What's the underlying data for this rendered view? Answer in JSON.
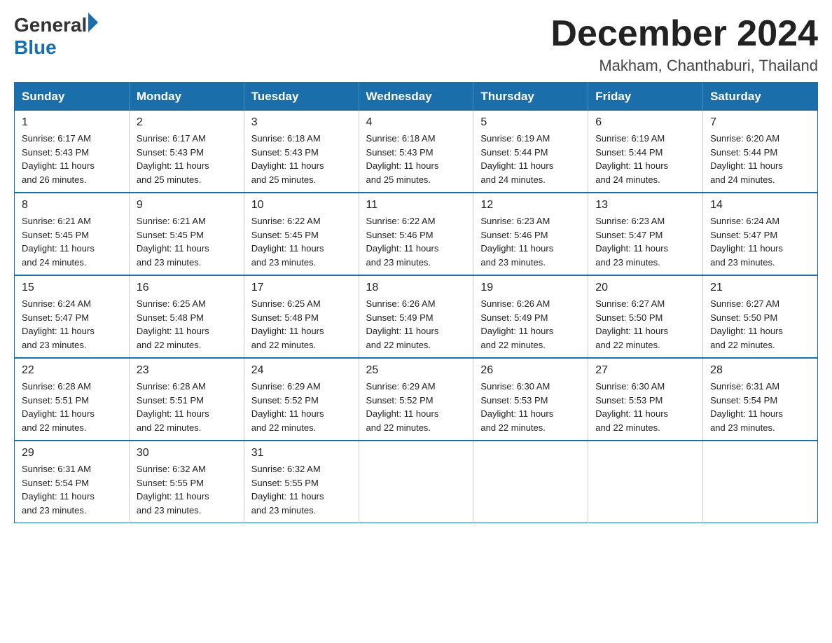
{
  "header": {
    "logo": {
      "general": "General",
      "blue": "Blue"
    },
    "month_year": "December 2024",
    "location": "Makham, Chanthaburi, Thailand"
  },
  "weekdays": [
    "Sunday",
    "Monday",
    "Tuesday",
    "Wednesday",
    "Thursday",
    "Friday",
    "Saturday"
  ],
  "weeks": [
    [
      {
        "day": "1",
        "sunrise": "6:17 AM",
        "sunset": "5:43 PM",
        "daylight": "11 hours and 26 minutes."
      },
      {
        "day": "2",
        "sunrise": "6:17 AM",
        "sunset": "5:43 PM",
        "daylight": "11 hours and 25 minutes."
      },
      {
        "day": "3",
        "sunrise": "6:18 AM",
        "sunset": "5:43 PM",
        "daylight": "11 hours and 25 minutes."
      },
      {
        "day": "4",
        "sunrise": "6:18 AM",
        "sunset": "5:43 PM",
        "daylight": "11 hours and 25 minutes."
      },
      {
        "day": "5",
        "sunrise": "6:19 AM",
        "sunset": "5:44 PM",
        "daylight": "11 hours and 24 minutes."
      },
      {
        "day": "6",
        "sunrise": "6:19 AM",
        "sunset": "5:44 PM",
        "daylight": "11 hours and 24 minutes."
      },
      {
        "day": "7",
        "sunrise": "6:20 AM",
        "sunset": "5:44 PM",
        "daylight": "11 hours and 24 minutes."
      }
    ],
    [
      {
        "day": "8",
        "sunrise": "6:21 AM",
        "sunset": "5:45 PM",
        "daylight": "11 hours and 24 minutes."
      },
      {
        "day": "9",
        "sunrise": "6:21 AM",
        "sunset": "5:45 PM",
        "daylight": "11 hours and 23 minutes."
      },
      {
        "day": "10",
        "sunrise": "6:22 AM",
        "sunset": "5:45 PM",
        "daylight": "11 hours and 23 minutes."
      },
      {
        "day": "11",
        "sunrise": "6:22 AM",
        "sunset": "5:46 PM",
        "daylight": "11 hours and 23 minutes."
      },
      {
        "day": "12",
        "sunrise": "6:23 AM",
        "sunset": "5:46 PM",
        "daylight": "11 hours and 23 minutes."
      },
      {
        "day": "13",
        "sunrise": "6:23 AM",
        "sunset": "5:47 PM",
        "daylight": "11 hours and 23 minutes."
      },
      {
        "day": "14",
        "sunrise": "6:24 AM",
        "sunset": "5:47 PM",
        "daylight": "11 hours and 23 minutes."
      }
    ],
    [
      {
        "day": "15",
        "sunrise": "6:24 AM",
        "sunset": "5:47 PM",
        "daylight": "11 hours and 23 minutes."
      },
      {
        "day": "16",
        "sunrise": "6:25 AM",
        "sunset": "5:48 PM",
        "daylight": "11 hours and 22 minutes."
      },
      {
        "day": "17",
        "sunrise": "6:25 AM",
        "sunset": "5:48 PM",
        "daylight": "11 hours and 22 minutes."
      },
      {
        "day": "18",
        "sunrise": "6:26 AM",
        "sunset": "5:49 PM",
        "daylight": "11 hours and 22 minutes."
      },
      {
        "day": "19",
        "sunrise": "6:26 AM",
        "sunset": "5:49 PM",
        "daylight": "11 hours and 22 minutes."
      },
      {
        "day": "20",
        "sunrise": "6:27 AM",
        "sunset": "5:50 PM",
        "daylight": "11 hours and 22 minutes."
      },
      {
        "day": "21",
        "sunrise": "6:27 AM",
        "sunset": "5:50 PM",
        "daylight": "11 hours and 22 minutes."
      }
    ],
    [
      {
        "day": "22",
        "sunrise": "6:28 AM",
        "sunset": "5:51 PM",
        "daylight": "11 hours and 22 minutes."
      },
      {
        "day": "23",
        "sunrise": "6:28 AM",
        "sunset": "5:51 PM",
        "daylight": "11 hours and 22 minutes."
      },
      {
        "day": "24",
        "sunrise": "6:29 AM",
        "sunset": "5:52 PM",
        "daylight": "11 hours and 22 minutes."
      },
      {
        "day": "25",
        "sunrise": "6:29 AM",
        "sunset": "5:52 PM",
        "daylight": "11 hours and 22 minutes."
      },
      {
        "day": "26",
        "sunrise": "6:30 AM",
        "sunset": "5:53 PM",
        "daylight": "11 hours and 22 minutes."
      },
      {
        "day": "27",
        "sunrise": "6:30 AM",
        "sunset": "5:53 PM",
        "daylight": "11 hours and 22 minutes."
      },
      {
        "day": "28",
        "sunrise": "6:31 AM",
        "sunset": "5:54 PM",
        "daylight": "11 hours and 23 minutes."
      }
    ],
    [
      {
        "day": "29",
        "sunrise": "6:31 AM",
        "sunset": "5:54 PM",
        "daylight": "11 hours and 23 minutes."
      },
      {
        "day": "30",
        "sunrise": "6:32 AM",
        "sunset": "5:55 PM",
        "daylight": "11 hours and 23 minutes."
      },
      {
        "day": "31",
        "sunrise": "6:32 AM",
        "sunset": "5:55 PM",
        "daylight": "11 hours and 23 minutes."
      },
      null,
      null,
      null,
      null
    ]
  ],
  "labels": {
    "sunrise": "Sunrise:",
    "sunset": "Sunset:",
    "daylight": "Daylight:"
  }
}
